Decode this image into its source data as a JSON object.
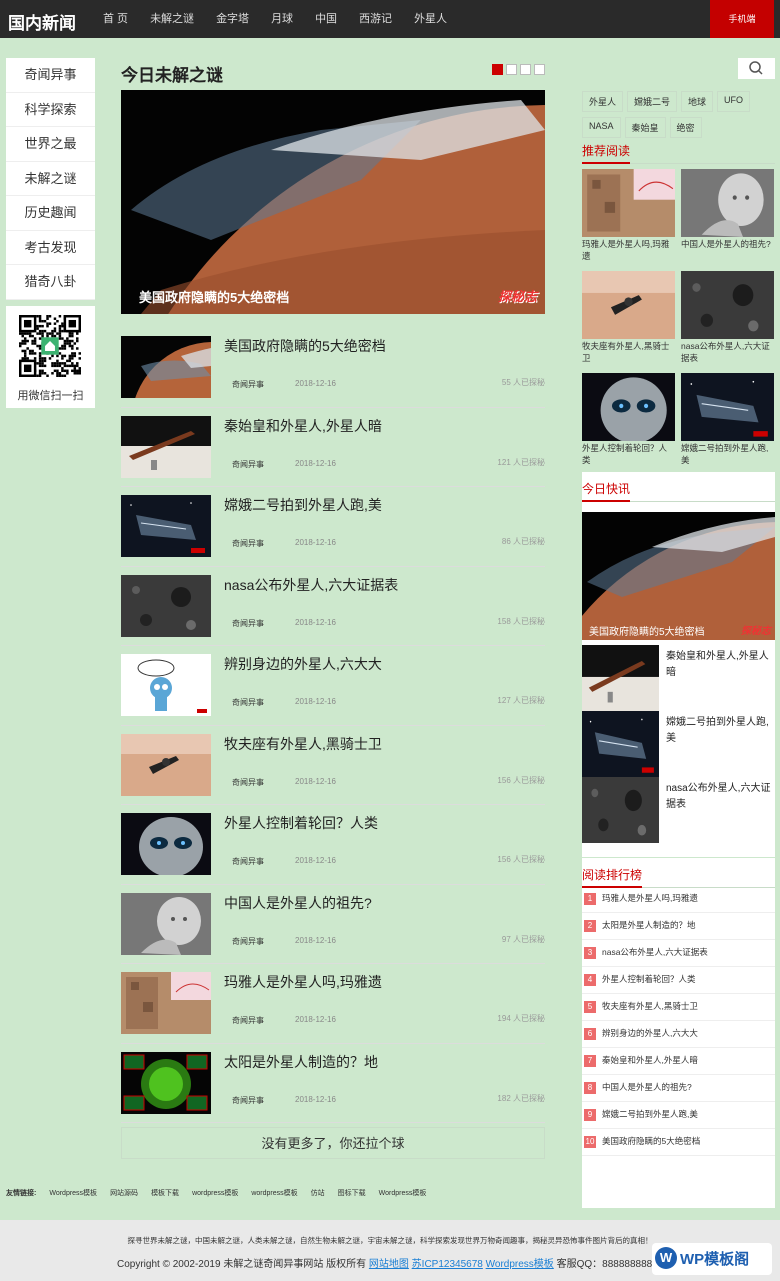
{
  "header": {
    "logo": "国内新闻",
    "nav": [
      "首 页",
      "未解之谜",
      "金字塔",
      "月球",
      "中国",
      "西游记",
      "外星人"
    ],
    "mobile": "手机端"
  },
  "left_nav": [
    "奇闻异事",
    "科学探索",
    "世界之最",
    "未解之谜",
    "历史趣闻",
    "考古发现",
    "猎奇八卦"
  ],
  "qr_label": "用微信扫一扫",
  "main": {
    "title": "今日未解之谜",
    "hero_caption": "美国政府隐瞒的5大绝密档",
    "watermark": "探秘志",
    "more": "没有更多了，你还拉个球",
    "articles": [
      {
        "title": "美国政府隐瞒的5大绝密档",
        "cat": "奇闻异事",
        "date": "2018-12-16",
        "views": "55 人已探秘",
        "img": "mars"
      },
      {
        "title": "秦始皇和外星人,外星人暗",
        "cat": "奇闻异事",
        "date": "2018-12-16",
        "views": "121 人已探秘",
        "img": "sword"
      },
      {
        "title": "嫦娥二号拍到外星人跑,美",
        "cat": "奇闻异事",
        "date": "2018-12-16",
        "views": "86 人已探秘",
        "img": "ship"
      },
      {
        "title": "nasa公布外星人,六大证据表",
        "cat": "奇闻异事",
        "date": "2018-12-16",
        "views": "158 人已探秘",
        "img": "moon"
      },
      {
        "title": "辨别身边的外星人,六大大",
        "cat": "奇闻异事",
        "date": "2018-12-16",
        "views": "127 人已探秘",
        "img": "cartoon"
      },
      {
        "title": "牧夫座有外星人,黑骑士卫",
        "cat": "奇闻异事",
        "date": "2018-12-16",
        "views": "156 人已探秘",
        "img": "sky"
      },
      {
        "title": "外星人控制着轮回？人类",
        "cat": "奇闻异事",
        "date": "2018-12-16",
        "views": "156 人已探秘",
        "img": "alien"
      },
      {
        "title": "中国人是外星人的祖先?",
        "cat": "奇闻异事",
        "date": "2018-12-16",
        "views": "97 人已探秘",
        "img": "statue"
      },
      {
        "title": "玛雅人是外星人吗,玛雅遗",
        "cat": "奇闻异事",
        "date": "2018-12-16",
        "views": "194 人已探秘",
        "img": "maya"
      },
      {
        "title": "太阳是外星人制造的？地",
        "cat": "奇闻异事",
        "date": "2018-12-16",
        "views": "182 人已探秘",
        "img": "sun"
      }
    ]
  },
  "sidebar": {
    "tags": [
      "外星人",
      "嫦娥二号",
      "地球",
      "UFO",
      "NASA",
      "秦始皇",
      "绝密"
    ],
    "recommend_title": "推荐阅读",
    "recommend": [
      {
        "title": "玛雅人是外星人吗,玛雅遗",
        "img": "maya"
      },
      {
        "title": "中国人是外星人的祖先?",
        "img": "statue"
      },
      {
        "title": "牧夫座有外星人,黑骑士卫",
        "img": "sky"
      },
      {
        "title": "nasa公布外星人,六大证据表",
        "img": "moon"
      },
      {
        "title": "外星人控制着轮回？人类",
        "img": "alien"
      },
      {
        "title": "嫦娥二号拍到外星人跑,美",
        "img": "ship"
      }
    ],
    "kuaixun_title": "今日快讯",
    "kuaixun_hero": "美国政府隐瞒的5大绝密档",
    "kuaixun": [
      {
        "title": "秦始皇和外星人,外星人暗",
        "img": "sword"
      },
      {
        "title": "嫦娥二号拍到外星人跑,美",
        "img": "ship"
      },
      {
        "title": "nasa公布外星人,六大证据表",
        "img": "moon"
      }
    ],
    "rank_title": "阅读排行榜",
    "rank": [
      "玛雅人是外星人吗,玛雅遗",
      "太阳是外星人制造的？地",
      "nasa公布外星人,六大证据表",
      "外星人控制着轮回？人类",
      "牧夫座有外星人,黑骑士卫",
      "辨别身边的外星人,六大大",
      "秦始皇和外星人,外星人暗",
      "中国人是外星人的祖先?",
      "嫦娥二号拍到外星人跑,美",
      "美国政府隐瞒的5大绝密档"
    ]
  },
  "links": {
    "label": "友情链接:",
    "items": [
      "Wordpress模板",
      "网站源码",
      "模板下载",
      "wordpress模板",
      "wordpress模板",
      "仿站",
      "图标下载",
      "Wordpress模板"
    ]
  },
  "footer": {
    "line1": "探寻世界未解之谜，中国未解之谜，人类未解之谜，自然生物未解之谜，宇宙未解之谜，科学探索发现世界万物奇闻趣事，揭秘灵异恐怖事件图片背后的真相！",
    "copyright": "Copyright © 2002-2019 未解之谜奇闻异事网站 版权所有",
    "sitemap": "网站地图",
    "icp": "苏ICP12345678",
    "wp": "Wordpress模板",
    "qq": "客服QQ：888888888",
    "badge": "WP模板阁"
  }
}
